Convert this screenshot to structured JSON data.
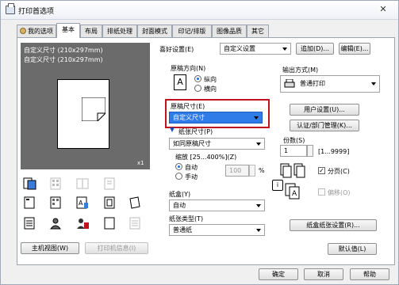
{
  "window": {
    "title": "打印首选项",
    "close_glyph": "✕"
  },
  "tabs": [
    {
      "label": "我的选项"
    },
    {
      "label": "基本"
    },
    {
      "label": "布局"
    },
    {
      "label": "排纸处理"
    },
    {
      "label": "封面模式"
    },
    {
      "label": "印记/排版"
    },
    {
      "label": "图像品质"
    },
    {
      "label": "其它"
    }
  ],
  "preview": {
    "line1": "自定义尺寸 (210x297mm)",
    "line2": "自定义尺寸 (210x297mm)",
    "scale": "x1"
  },
  "favorites": {
    "label": "喜好设置(E)",
    "value": "自定义设置",
    "add_button": "追加(D)...",
    "edit_button": "编辑(E)..."
  },
  "orientation": {
    "label": "原稿方向(N)",
    "portrait": "纵向",
    "landscape": "横向",
    "icon_letter": "A"
  },
  "original_size": {
    "label": "原稿尺寸(E)",
    "value": "自定义尺寸"
  },
  "paper_size": {
    "label": "纸张尺寸(P)",
    "value": "如同原稿尺寸"
  },
  "zoom": {
    "label": "缩放 [25...400%](Z)",
    "auto": "自动",
    "manual": "手动",
    "value": "100",
    "unit": "%"
  },
  "tray": {
    "label": "纸盒(Y)",
    "value": "自动"
  },
  "paper_type": {
    "label": "纸张类型(T)",
    "value": "普通纸"
  },
  "output": {
    "label": "输出方式(M)",
    "value": "普通打印"
  },
  "user_settings_button": "用户设置(U)...",
  "auth_button": "认证/部门管理(K)...",
  "copies": {
    "label": "份数(S)",
    "value": "1",
    "range": "[1...9999]"
  },
  "collate": {
    "label": "分页(C)"
  },
  "offset": {
    "label": "偏移(O)"
  },
  "tray_paper_button": "纸盒纸张设置(R)...",
  "default_button": "默认值(L)",
  "bottom": {
    "printer_view": "主机视图(W)",
    "printer_info": "打印机信息(I)",
    "ok": "确定",
    "cancel": "取消",
    "help": "帮助"
  },
  "colors": {
    "highlight_border": "#c0141c",
    "selection": "#2f7be8"
  }
}
